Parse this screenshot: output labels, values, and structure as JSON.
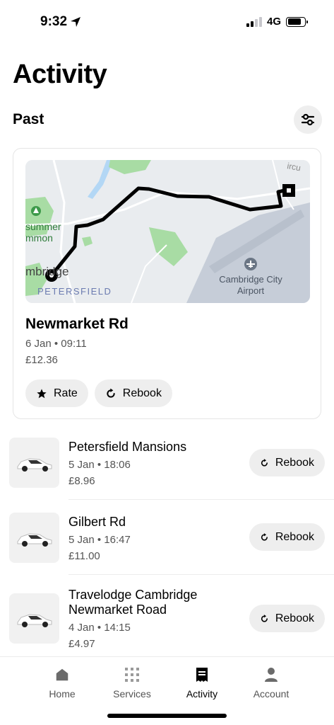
{
  "status_bar": {
    "time": "9:32",
    "network": "4G"
  },
  "header": {
    "title": "Activity",
    "section": "Past"
  },
  "featured_trip": {
    "destination": "Newmarket Rd",
    "datetime": "6 Jan • 09:11",
    "price": "£12.36",
    "rate_label": "Rate",
    "rebook_label": "Rebook",
    "map_labels": {
      "common_line1": "summer",
      "common_line2": "mmon",
      "town": "mbridge",
      "district": "PETERSFIELD",
      "airport_line1": "Cambridge City",
      "airport_line2": "Airport",
      "corner": "ircu"
    }
  },
  "trips": [
    {
      "name": "Petersfield Mansions",
      "datetime": "5 Jan • 18:06",
      "price": "£8.96",
      "rebook_label": "Rebook"
    },
    {
      "name": "Gilbert Rd",
      "datetime": "5 Jan • 16:47",
      "price": "£11.00",
      "rebook_label": "Rebook"
    },
    {
      "name": "Travelodge Cambridge Newmarket Road",
      "datetime": "4 Jan • 14:15",
      "price": "£4.97",
      "rebook_label": "Rebook"
    }
  ],
  "nav": {
    "home": "Home",
    "services": "Services",
    "activity": "Activity",
    "account": "Account",
    "active": "activity"
  },
  "colors": {
    "map_bg": "#e9ecef",
    "park": "#a8dca4",
    "water": "#b3d7f5",
    "airport": "#c6cdd8"
  }
}
